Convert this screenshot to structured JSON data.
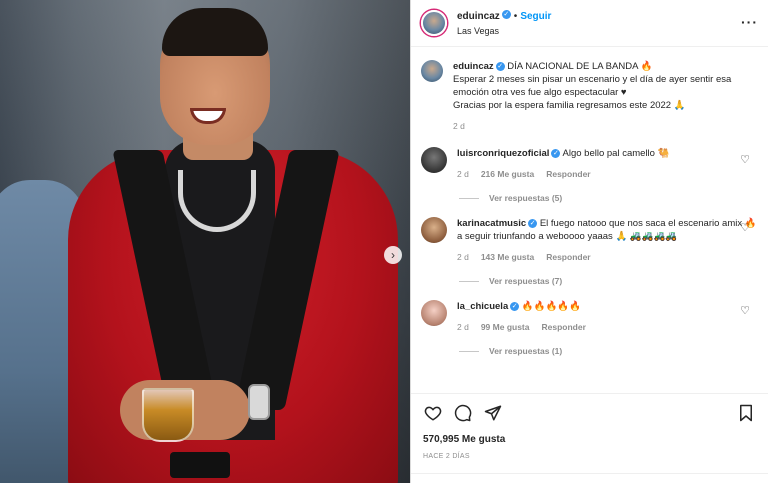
{
  "post": {
    "username": "eduincaz",
    "follow_label": "Seguir",
    "location": "Las Vegas",
    "more_label": "···",
    "next_label": "›",
    "caption": {
      "title": "DÍA NACIONAL DE LA BANDA 🔥",
      "text": "Esperar 2 meses sin pisar un escenario y el día de ayer sentir esa emoción otra ves fue algo espectacular ♥",
      "text2": "Gracias por la espera familia regresamos este 2022 🙏",
      "time": "2 d"
    },
    "likes": "570,995 Me gusta",
    "posted_ago": "HACE 2 DÍAS"
  },
  "comments": [
    {
      "username": "luisrconriquezoficial",
      "text": "Algo bello pal camello 🐫",
      "time": "2 d",
      "likes": "216 Me gusta",
      "reply_label": "Responder",
      "view_replies": "Ver respuestas (5)"
    },
    {
      "username": "karinacatmusic",
      "text": "El fuego natooo que nos saca el escenario amix 🔥 a seguir triunfando a weboooo yaaas 🙏 🚜🚜🚜🚜",
      "time": "2 d",
      "likes": "143 Me gusta",
      "reply_label": "Responder",
      "view_replies": "Ver respuestas (7)"
    },
    {
      "username": "la_chicuela",
      "text": "🔥🔥🔥🔥🔥",
      "time": "2 d",
      "likes": "99 Me gusta",
      "reply_label": "Responder",
      "view_replies": "Ver respuestas (1)"
    }
  ],
  "colors": {
    "accent": "#0095f6",
    "verified": "#3897f0",
    "jacket": "#b3121c"
  }
}
